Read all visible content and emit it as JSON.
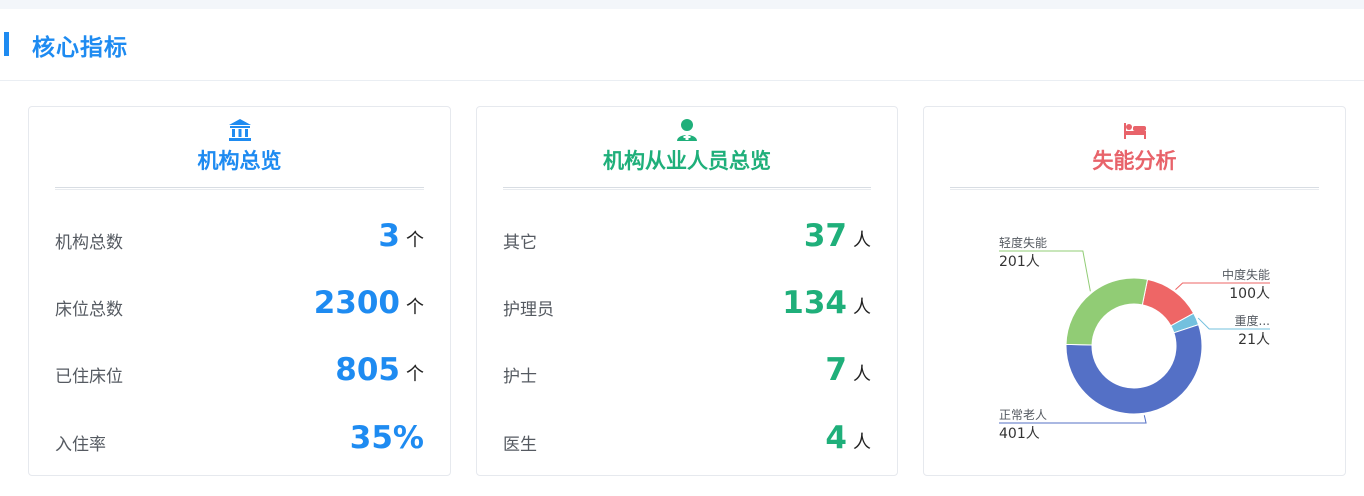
{
  "header": {
    "title": "核心指标"
  },
  "cards": {
    "institution": {
      "title": "机构总览",
      "icon": "bank-icon",
      "accent": "#1e8bf1",
      "rows": [
        {
          "label": "机构总数",
          "value": "3",
          "unit": "个"
        },
        {
          "label": "床位总数",
          "value": "2300",
          "unit": "个"
        },
        {
          "label": "已住床位",
          "value": "805",
          "unit": "个"
        },
        {
          "label": "入住率",
          "value": "35%",
          "unit": ""
        }
      ]
    },
    "staff": {
      "title": "机构从业人员总览",
      "icon": "nurse-icon",
      "accent": "#1faf7a",
      "rows": [
        {
          "label": "其它",
          "value": "37",
          "unit": "人"
        },
        {
          "label": "护理员",
          "value": "134",
          "unit": "人"
        },
        {
          "label": "护士",
          "value": "7",
          "unit": "人"
        },
        {
          "label": "医生",
          "value": "4",
          "unit": "人"
        }
      ]
    },
    "disability": {
      "title": "失能分析",
      "icon": "bed-icon",
      "accent": "#e8636a"
    }
  },
  "chart_data": {
    "type": "pie",
    "donut": true,
    "series": [
      {
        "name": "正常老人",
        "value": 401,
        "label": "401人",
        "color": "#5470c6"
      },
      {
        "name": "轻度失能",
        "value": 201,
        "label": "201人",
        "color": "#91cc75"
      },
      {
        "name": "中度失能",
        "value": 100,
        "label": "100人",
        "color": "#ee6666"
      },
      {
        "name": "重度...",
        "value": 21,
        "label": "21人",
        "color": "#73c0de"
      }
    ]
  }
}
